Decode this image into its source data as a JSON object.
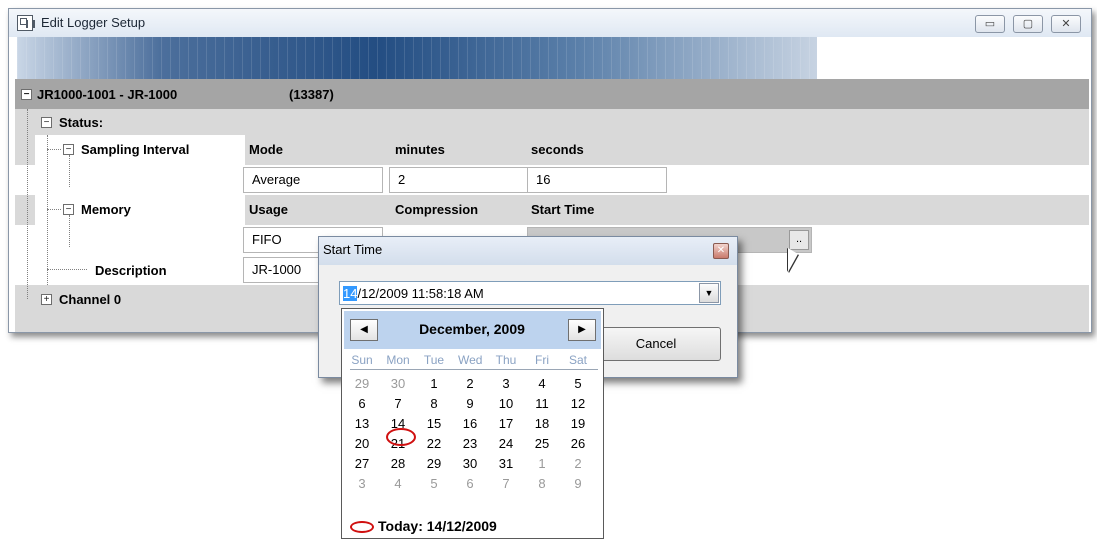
{
  "window": {
    "title": "Edit Logger Setup",
    "controls": {
      "minimize": "▭",
      "restore": "▢",
      "close": "✕"
    }
  },
  "tree": {
    "root_label": "JR1000-1001 - JR-1000",
    "root_id": "(13387)",
    "status_label": "Status:",
    "sampling_label": "Sampling Interval",
    "sampling_headers": [
      "Mode",
      "minutes",
      "seconds"
    ],
    "sampling_values": [
      "Average",
      "2",
      "16"
    ],
    "memory_label": "Memory",
    "memory_headers": [
      "Usage",
      "Compression",
      "Start Time"
    ],
    "memory_values": [
      "FIFO",
      "",
      ""
    ],
    "start_time_button": "..",
    "description_label": "Description",
    "description_value": "JR-1000",
    "channel_label": "Channel 0",
    "expander_minus": "−",
    "expander_plus": "+"
  },
  "dialog": {
    "title": "Start Time",
    "close": "✕",
    "datetime_selected": "14",
    "datetime_rest": "/12/2009 11:58:18 AM",
    "dropdown_arrow": "▼",
    "cancel_label": "Cancel"
  },
  "calendar": {
    "prev": "◀",
    "next": "▶",
    "month_title": "December, 2009",
    "weekdays": [
      "Sun",
      "Mon",
      "Tue",
      "Wed",
      "Thu",
      "Fri",
      "Sat"
    ],
    "weeks": [
      [
        "29",
        "30",
        "1",
        "2",
        "3",
        "4",
        "5"
      ],
      [
        "6",
        "7",
        "8",
        "9",
        "10",
        "11",
        "12"
      ],
      [
        "13",
        "14",
        "15",
        "16",
        "17",
        "18",
        "19"
      ],
      [
        "20",
        "21",
        "22",
        "23",
        "24",
        "25",
        "26"
      ],
      [
        "27",
        "28",
        "29",
        "30",
        "31",
        "1",
        "2"
      ],
      [
        "3",
        "4",
        "5",
        "6",
        "7",
        "8",
        "9"
      ]
    ],
    "dim": [
      [
        true,
        true,
        false,
        false,
        false,
        false,
        false
      ],
      [
        false,
        false,
        false,
        false,
        false,
        false,
        false
      ],
      [
        false,
        false,
        false,
        false,
        false,
        false,
        false
      ],
      [
        false,
        false,
        false,
        false,
        false,
        false,
        false
      ],
      [
        false,
        false,
        false,
        false,
        false,
        true,
        true
      ],
      [
        true,
        true,
        true,
        true,
        true,
        true,
        true
      ]
    ],
    "today_text": "Today: 14/12/2009",
    "today_color": "#d01010",
    "header_color": "#bdd3ee"
  }
}
